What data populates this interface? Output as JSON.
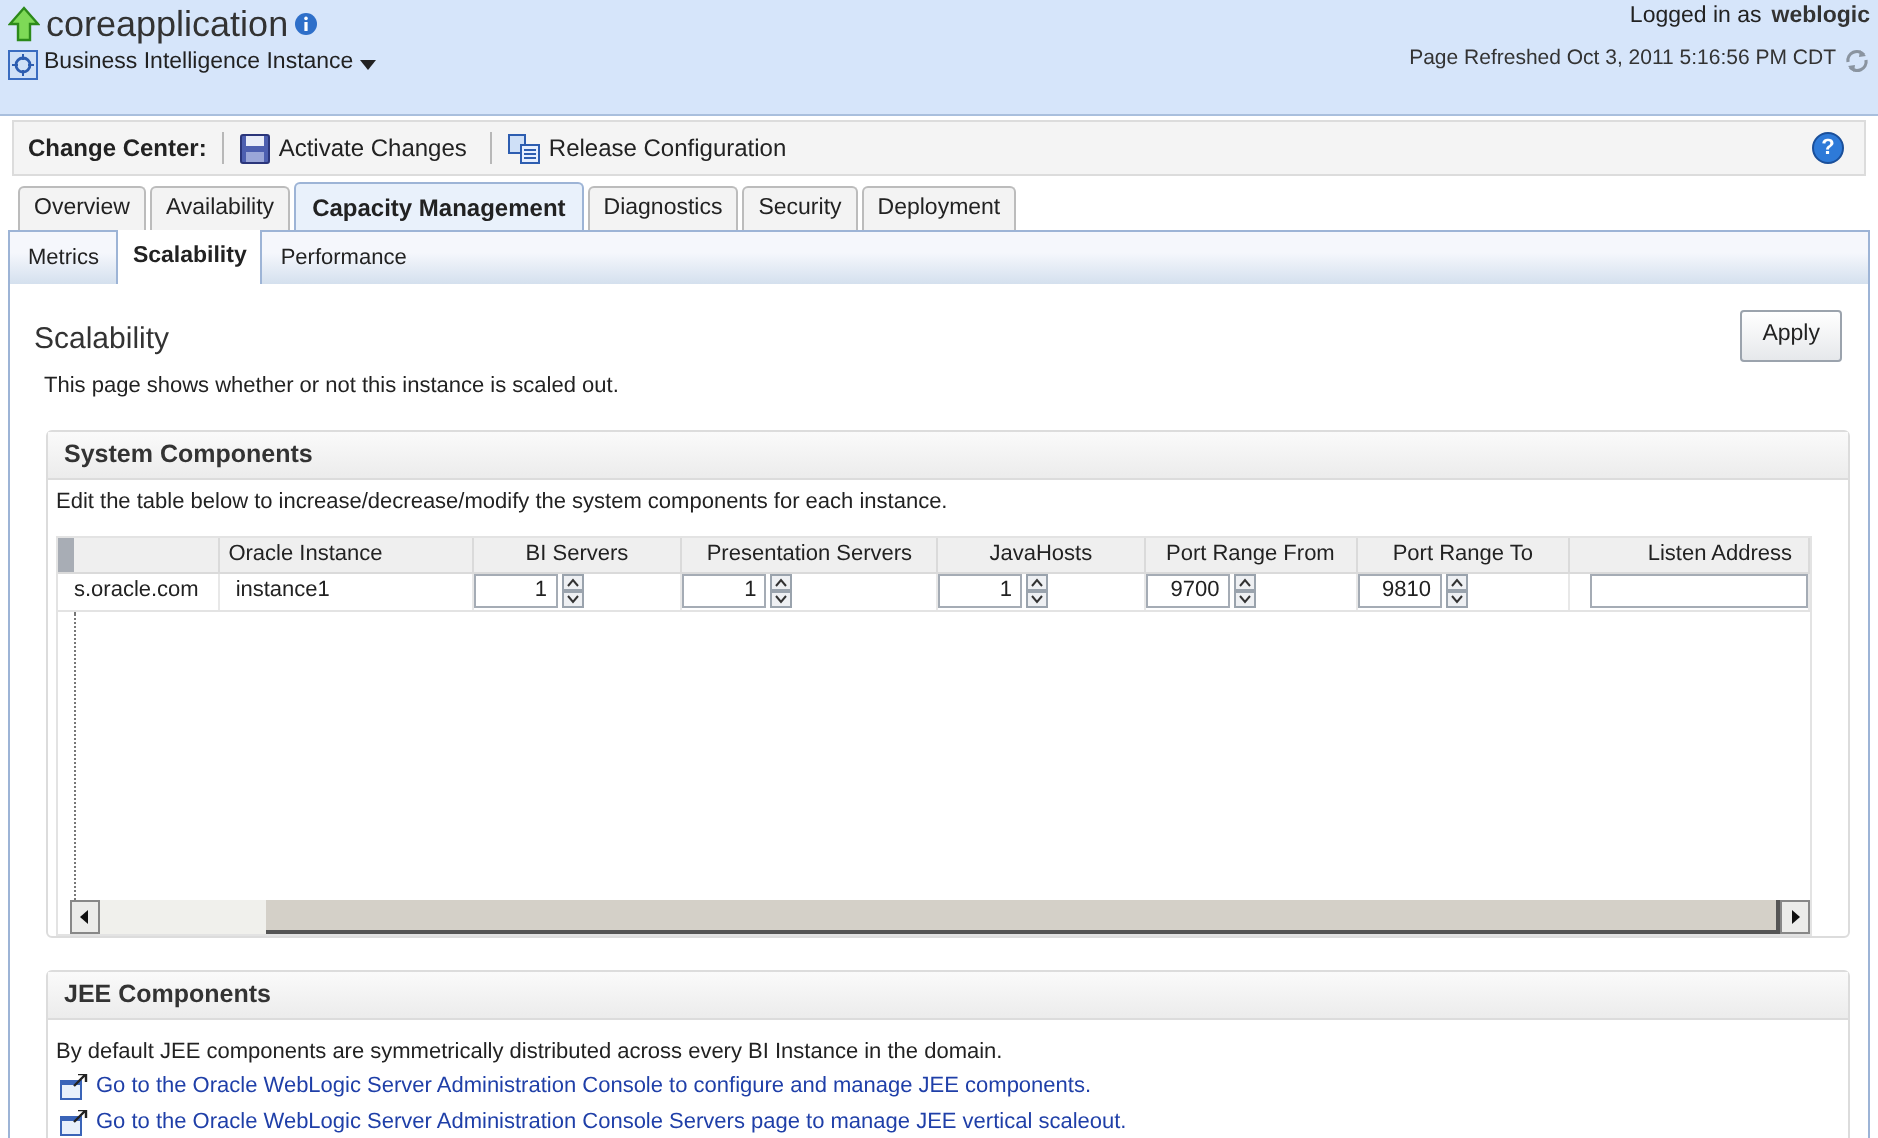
{
  "header": {
    "title": "coreapplication",
    "instance_menu": "Business Intelligence Instance",
    "logged_in_label": "Logged in as",
    "user": "weblogic",
    "refreshed": "Page Refreshed Oct 3, 2011 5:16:56 PM CDT"
  },
  "change_center": {
    "label": "Change Center:",
    "help_button": "?",
    "actions": [
      {
        "kind": "save",
        "label": "Activate Changes"
      },
      {
        "kind": "release",
        "label": "Release Configuration"
      }
    ]
  },
  "tabs": [
    {
      "label": "Overview",
      "selected": false
    },
    {
      "label": "Availability",
      "selected": false
    },
    {
      "label": "Capacity Management",
      "selected": true
    },
    {
      "label": "Diagnostics",
      "selected": false
    },
    {
      "label": "Security",
      "selected": false
    },
    {
      "label": "Deployment",
      "selected": false
    }
  ],
  "subtabs": [
    {
      "label": "Metrics",
      "selected": false
    },
    {
      "label": "Scalability",
      "selected": true
    },
    {
      "label": "Performance",
      "selected": false
    }
  ],
  "page": {
    "title": "Scalability",
    "description": "This page shows whether or not this instance is scaled out.",
    "apply_button": "Apply"
  },
  "system_components": {
    "title": "System Components",
    "description": "Edit the table below to increase/decrease/modify the system components for each instance.",
    "table": {
      "columns": [
        "",
        "Oracle Instance",
        "BI Servers",
        "Presentation Servers",
        "JavaHosts",
        "Port Range From",
        "Port Range To",
        "Listen Address"
      ],
      "rows": [
        {
          "cells": [
            {
              "kind": "text",
              "value": "s.oracle.com"
            },
            {
              "kind": "text",
              "value": "instance1"
            },
            {
              "kind": "spinner",
              "value": "1"
            },
            {
              "kind": "spinner",
              "value": "1"
            },
            {
              "kind": "spinner",
              "value": "1"
            },
            {
              "kind": "spinner",
              "value": "9700"
            },
            {
              "kind": "spinner",
              "value": "9810"
            },
            {
              "kind": "input"
            }
          ]
        }
      ]
    }
  },
  "jee_components": {
    "title": "JEE Components",
    "description": "By default JEE components are symmetrically distributed across every BI Instance in the domain.",
    "links": [
      "Go to the Oracle WebLogic Server Administration Console to configure and manage JEE components.",
      "Go to the Oracle WebLogic Server Administration Console Servers page to manage JEE vertical scaleout."
    ]
  }
}
